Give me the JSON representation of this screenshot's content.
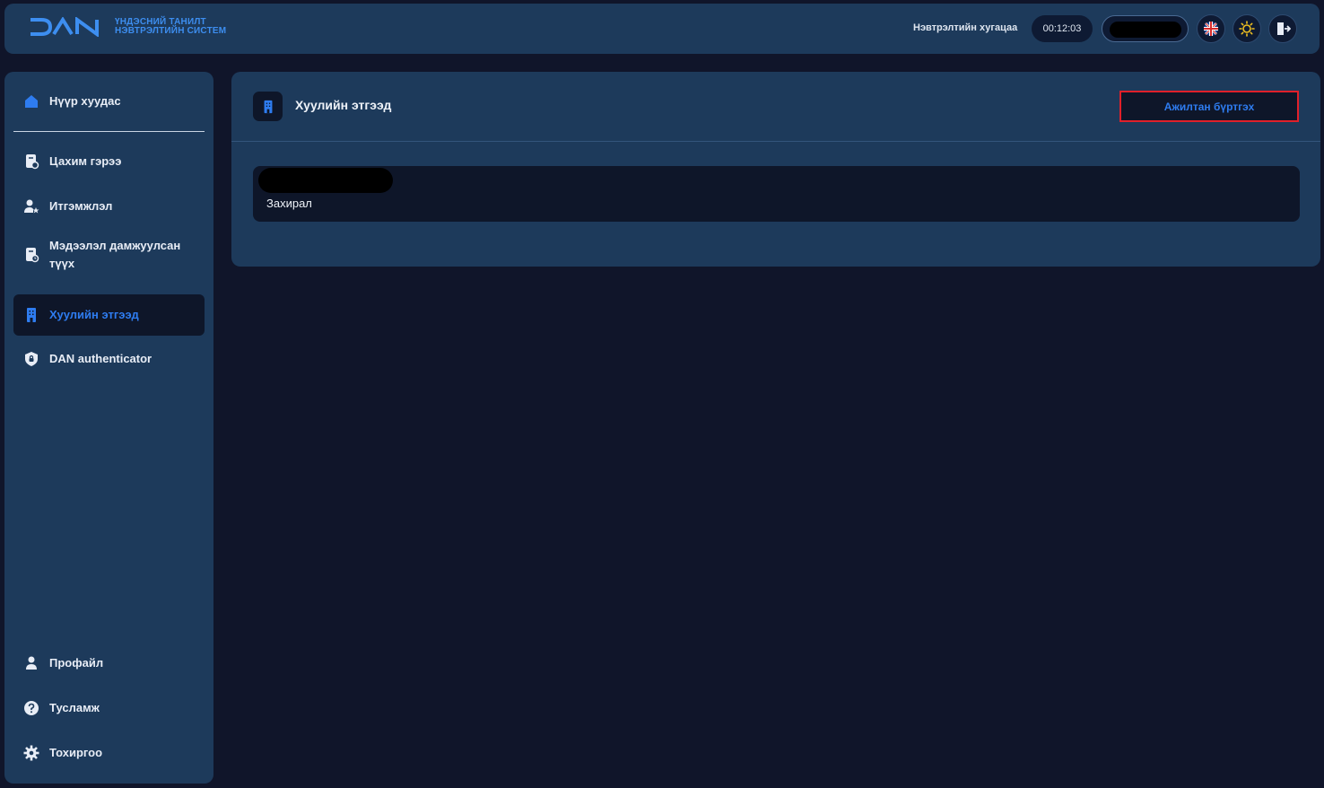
{
  "header": {
    "logo_text": "DAN",
    "system_line1": "ҮНДЭСНИЙ ТАНИЛТ",
    "system_line2": "НЭВТРЭЛТИЙН СИСТЕМ",
    "session_label": "Нэвтрэлтийн хугацаа",
    "session_timer": "00:12:03",
    "user_name": "",
    "icons": [
      "uk-flag-icon",
      "sun-icon",
      "logout-icon"
    ]
  },
  "sidebar": {
    "home_label": "Нүүр хуудас",
    "items": [
      {
        "label": "Цахим гэрээ",
        "icon": "document-icon"
      },
      {
        "label": "Итгэмжлэл",
        "icon": "user-star-icon"
      },
      {
        "label": "Мэдээлэл дамжуулсан түүх",
        "icon": "history-document-icon"
      },
      {
        "label": "Хуулийн этгээд",
        "icon": "building-icon",
        "active": true
      },
      {
        "label": "DAN authenticator",
        "icon": "shield-icon"
      }
    ],
    "bottom_items": [
      {
        "label": "Профайл",
        "icon": "person-icon"
      },
      {
        "label": "Тусламж",
        "icon": "help-icon"
      },
      {
        "label": "Тохиргоо",
        "icon": "settings-icon"
      }
    ]
  },
  "main": {
    "title": "Хуулийн этгээд",
    "register_button": "Ажилтан бүртгэх",
    "entity": {
      "name": "",
      "role": "Захирал"
    }
  },
  "colors": {
    "background": "#10152a",
    "panel": "#1d3a5b",
    "dark": "#0e1629",
    "accent": "#2e7cf0",
    "highlight_border": "#e0202a"
  }
}
